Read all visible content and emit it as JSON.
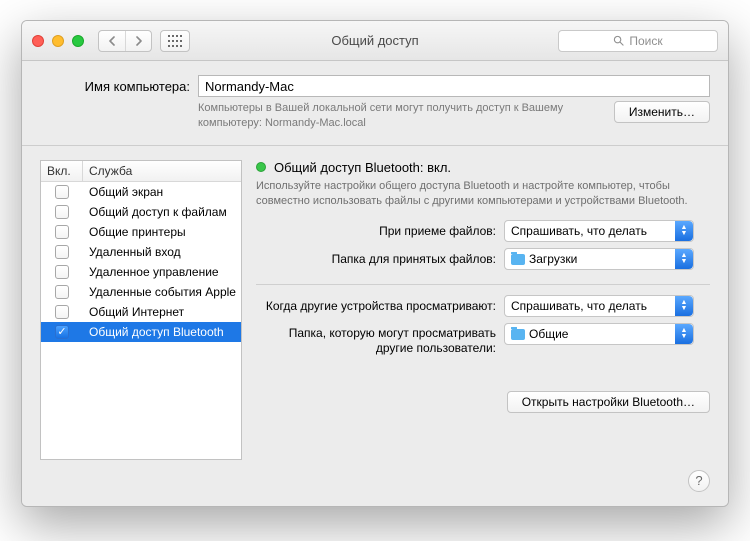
{
  "window": {
    "title": "Общий доступ",
    "search_placeholder": "Поиск"
  },
  "computer": {
    "label": "Имя компьютера:",
    "value": "Normandy-Mac",
    "note": "Компьютеры в Вашей локальной сети могут получить доступ к Вашему компьютеру: Normandy-Mac.local",
    "edit_button": "Изменить…"
  },
  "services": {
    "col_on": "Вкл.",
    "col_service": "Служба",
    "items": [
      {
        "label": "Общий экран",
        "checked": false,
        "selected": false
      },
      {
        "label": "Общий доступ к файлам",
        "checked": false,
        "selected": false
      },
      {
        "label": "Общие принтеры",
        "checked": false,
        "selected": false
      },
      {
        "label": "Удаленный вход",
        "checked": false,
        "selected": false
      },
      {
        "label": "Удаленное управление",
        "checked": false,
        "selected": false
      },
      {
        "label": "Удаленные события Apple",
        "checked": false,
        "selected": false
      },
      {
        "label": "Общий Интернет",
        "checked": false,
        "selected": false
      },
      {
        "label": "Общий доступ Bluetooth",
        "checked": true,
        "selected": true
      }
    ]
  },
  "detail": {
    "title": "Общий доступ Bluetooth: вкл.",
    "description": "Используйте настройки общего доступа Bluetooth и настройте компьютер, чтобы совместно использовать файлы с другими компьютерами и устройствами Bluetooth.",
    "row_receive_label": "При приеме файлов:",
    "row_receive_value": "Спрашивать, что делать",
    "row_folder_label": "Папка для принятых файлов:",
    "row_folder_value": "Загрузки",
    "row_browse_label": "Когда другие устройства просматривают:",
    "row_browse_value": "Спрашивать, что делать",
    "row_share_label": "Папка, которую могут просматривать другие пользователи:",
    "row_share_value": "Общие",
    "open_bt_button": "Открыть настройки Bluetooth…"
  }
}
